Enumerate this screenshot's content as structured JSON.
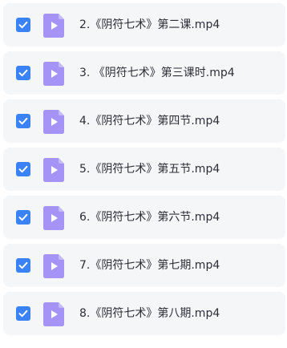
{
  "colors": {
    "checkbox_checked": "#3b82f6",
    "video_icon": "#a593f5",
    "video_icon_fold": "#c6bbfa",
    "row_background": "#f5f6f8",
    "text": "#2b2f36"
  },
  "file_list": {
    "items": [
      {
        "checked": true,
        "icon": "video-file-icon",
        "name": "2.《阴符七术》第二课.mp4"
      },
      {
        "checked": true,
        "icon": "video-file-icon",
        "name": "3. 《阴符七术》第三课时.mp4"
      },
      {
        "checked": true,
        "icon": "video-file-icon",
        "name": "4.《阴符七术》第四节.mp4"
      },
      {
        "checked": true,
        "icon": "video-file-icon",
        "name": "5.《阴符七术》第五节.mp4"
      },
      {
        "checked": true,
        "icon": "video-file-icon",
        "name": "6.《阴符七术》第六节.mp4"
      },
      {
        "checked": true,
        "icon": "video-file-icon",
        "name": "7.《阴符七术》第七期.mp4"
      },
      {
        "checked": true,
        "icon": "video-file-icon",
        "name": "8.《阴符七术》第八期.mp4"
      }
    ]
  }
}
